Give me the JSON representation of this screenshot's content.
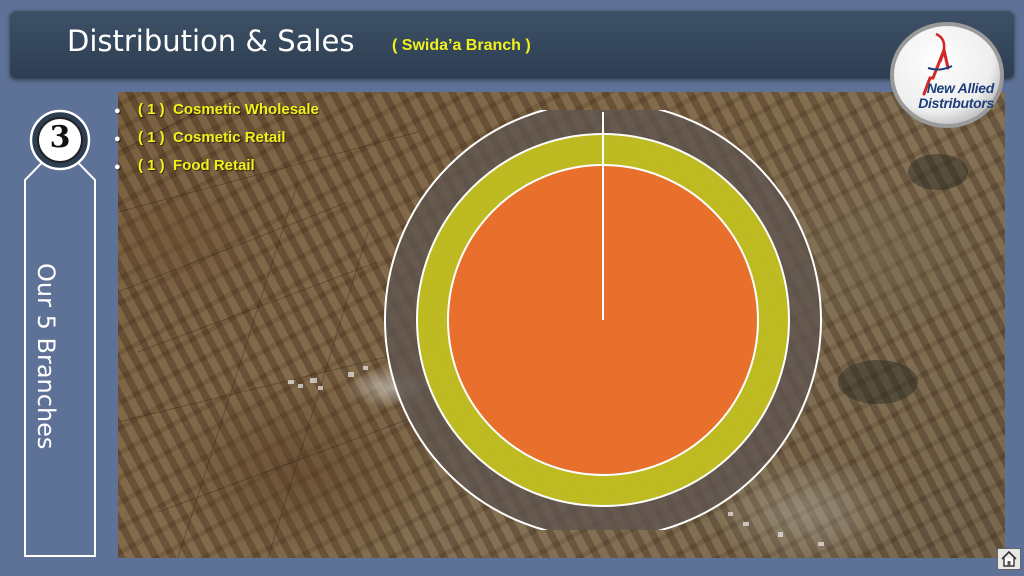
{
  "header": {
    "title": "Distribution & Sales",
    "subtitle": "( Swida’a Branch )"
  },
  "logo": {
    "line1": "New Allied",
    "line2": "Distributors"
  },
  "side_panel": {
    "badge_number": "3",
    "label": "Our 5 Branches"
  },
  "bullets": [
    {
      "count": "( 1 )",
      "label": "Cosmetic Wholesale"
    },
    {
      "count": "( 1 )",
      "label": "Cosmetic Retail"
    },
    {
      "count": "( 1 )",
      "label": "Food Retail"
    }
  ],
  "rings": [
    {
      "name": "outer",
      "color": "#5f5550"
    },
    {
      "name": "middle",
      "color": "#c8c51e"
    },
    {
      "name": "inner",
      "color": "#e8702c"
    }
  ],
  "colors": {
    "background": "#5e7196",
    "header": "#33465a",
    "accent_yellow": "#f2f21a",
    "logo_red": "#d22727",
    "logo_blue": "#1d3e7a"
  },
  "icons": {
    "home": "home-icon"
  }
}
